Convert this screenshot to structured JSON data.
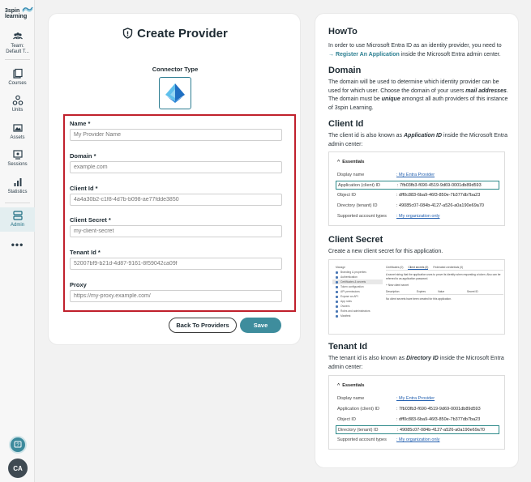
{
  "sidebar": {
    "logo_text_line1": "3spin",
    "logo_text_line2": "learning",
    "items": [
      {
        "label": "Team:",
        "label2": "Default T..."
      },
      {
        "label": "Courses"
      },
      {
        "label": "Units"
      },
      {
        "label": "Assets"
      },
      {
        "label": "Sessions"
      },
      {
        "label": "Statistics"
      },
      {
        "label": "Admin"
      }
    ],
    "more": "•••",
    "avatar": "CA"
  },
  "form": {
    "title": "Create Provider",
    "connector_label": "Connector Type",
    "fields": [
      {
        "label": "Name *",
        "placeholder": "My Provider Name"
      },
      {
        "label": "Domain *",
        "placeholder": "example.com"
      },
      {
        "label": "Client Id *",
        "placeholder": "4a4a30b2-c1f8-4d7b-b098-ae77fdde3850"
      },
      {
        "label": "Client Secret *",
        "placeholder": "my-client-secret"
      },
      {
        "label": "Tenant Id *",
        "placeholder": "52007bf9-b21d-4d87-9161-8f59042ca09f"
      },
      {
        "label": "Proxy",
        "placeholder": "https://my-proxy.example.com/"
      }
    ],
    "back_label": "Back To Providers",
    "save_label": "Save"
  },
  "howto": {
    "title": "HowTo",
    "intro_1": "In order to use Microsoft Entra ID as an identity provider, you need to",
    "intro_link": "→ Register An Application",
    "intro_2": " inside the Microsoft Entra admin center.",
    "domain_title": "Domain",
    "domain_1": "The domain will be used to determine which identity provider can be used for which user. Choose the domain of your users ",
    "domain_em1": "mail addresses",
    "domain_2": ". The domain must be ",
    "domain_em2": "unique",
    "domain_3": " amongst all auth providers of this instance of 3spin Learning.",
    "clientid_title": "Client Id",
    "clientid_1": "The client id is also known as ",
    "clientid_em": "Application ID",
    "clientid_2": " inside the Microsoft Entra admin center:",
    "secret_title": "Client Secret",
    "secret_text": "Create a new client secret for this application.",
    "tenant_title": "Tenant Id",
    "tenant_1": "The tenant id is also known as ",
    "tenant_em": "Directory ID",
    "tenant_2": " inside the Microsoft Entra admin center:",
    "essentials": {
      "head": "Essentials",
      "rows": [
        {
          "k": "Display name",
          "v": ": My Entra Provider"
        },
        {
          "k": "Application (client) ID",
          "v": ": 7fb03fb3-f690-4519-9d69-0001db89d593"
        },
        {
          "k": "Object ID",
          "v": ": dff0c883-6ba9-46f3-850e-7b377db7ba23"
        },
        {
          "k": "Directory (tenant) ID",
          "v": ": 49085c07-084b-4127-a526-a0a190e69a70"
        },
        {
          "k": "Supported account types",
          "v": ": My organization only"
        }
      ]
    },
    "secret_shot": {
      "side": [
        "Manage",
        "Branding & properties",
        "Authentication",
        "Certificates & secrets",
        "Token configuration",
        "API permissions",
        "Expose an API",
        "App roles",
        "Owners",
        "Roles and administrators",
        "Manifest"
      ],
      "tabs": [
        "Certificates (0)",
        "Client secrets (0)",
        "Federated credentials (0)"
      ],
      "desc": "A secret string that the application uses to prove its identity when requesting a token. Also can be referred to as application password.",
      "new": "+ New client secret",
      "cols": [
        "Description",
        "Expires",
        "Value",
        "Secret ID"
      ],
      "empty": "No client secrets have been created for this application."
    }
  },
  "colors": {
    "accent": "#3e8d9d",
    "highlight": "#c0202c"
  }
}
